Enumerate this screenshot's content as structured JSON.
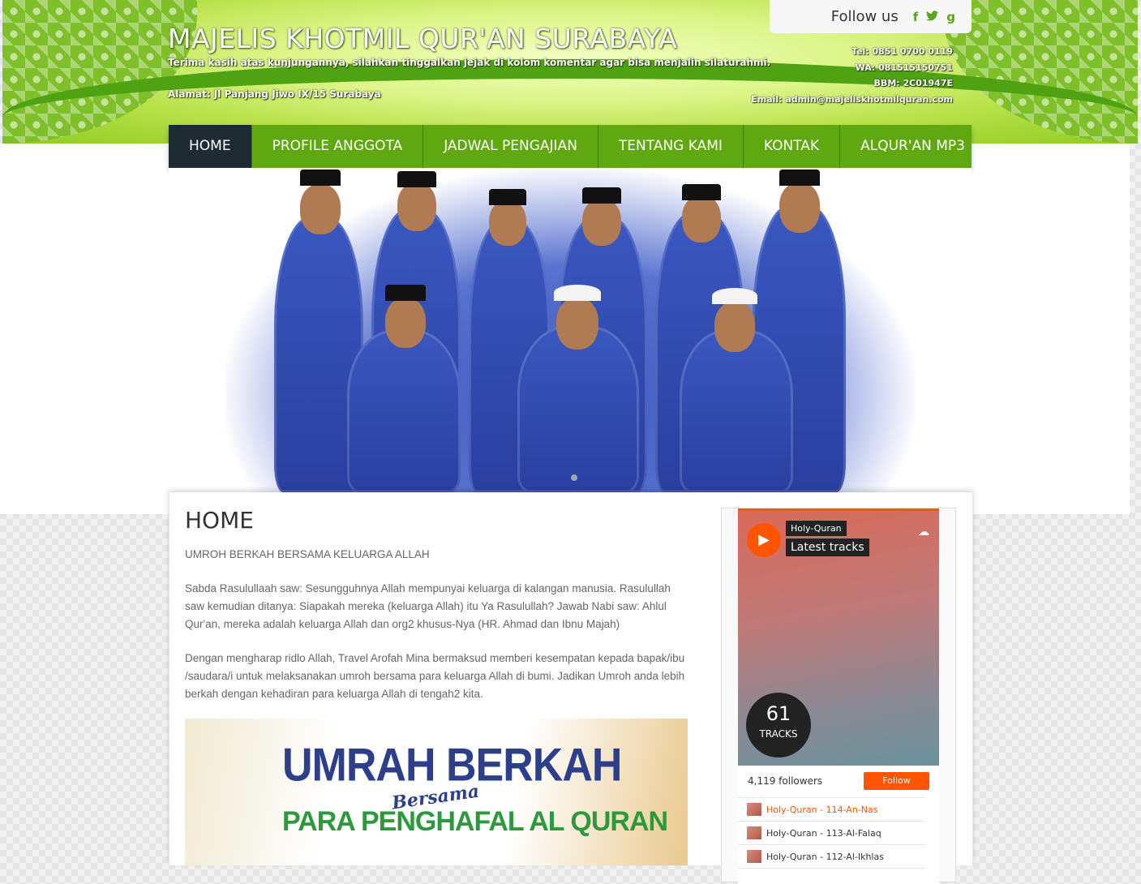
{
  "header": {
    "title": "MAJELIS KHOTMIL QUR'AN SURABAYA",
    "tagline": "Terima kasih atas kunjungannya, silahkan tinggalkan jejak di kolom komentar agar bisa menjalin silaturahmi.",
    "address": "Alamat: Jl Panjang Jiwo IX/15 Surabaya",
    "contact": {
      "tel": "Tel: 0851 0700 0119",
      "wa": "WA: 081515150751",
      "bbm": "BBM: 2C01947E",
      "email": "Email: admin@majeliskhotmilquran.com"
    },
    "follow": {
      "label": "Follow us",
      "icons": [
        "facebook-icon",
        "twitter-icon",
        "google-plus-icon"
      ]
    }
  },
  "nav": {
    "items": [
      {
        "label": "HOME",
        "active": true
      },
      {
        "label": "PROFILE ANGGOTA"
      },
      {
        "label": "JADWAL PENGAJIAN"
      },
      {
        "label": "TENTANG KAMI"
      },
      {
        "label": "KONTAK"
      },
      {
        "label": "ALQUR'AN MP3"
      }
    ]
  },
  "main": {
    "title": "HOME",
    "paragraphs": [
      "UMROH BERKAH BERSAMA KELUARGA ALLAH",
      "Sabda Rasulullaah saw: Sesungguhnya Allah mempunyai keluarga di kalangan manusia. Rasulullah saw kemudian ditanya: Siapakah mereka (keluarga Allah) itu Ya Rasulullah? Jawab Nabi saw: Ahlul Qur'an, mereka adalah keluarga Allah dan org2 khusus-Nya (HR. Ahmad dan Ibnu Majah)",
      "Dengan mengharap ridlo Allah, Travel Arofah Mina bermaksud memberi kesempatan kepada bapak/ibu /saudara/i untuk melaksanakan umroh bersama para keluarga Allah di bumi. Jadikan Umroh anda lebih berkah dengan kehadiran para keluarga Allah di tengah2 kita."
    ],
    "banner": {
      "line1": "UMRAH BERKAH",
      "line2": "Bersama",
      "line3": "PARA PENGHAFAL AL QURAN"
    }
  },
  "soundcloud": {
    "user": "Holy-Quran",
    "playlist": "Latest tracks",
    "track_count": "61",
    "track_label": "TRACKS",
    "followers": "4,119 followers",
    "follow_label": "Follow",
    "tracks": [
      "Holy-Quran - 114-An-Nas",
      "Holy-Quran - 113-Al-Falaq",
      "Holy-Quran - 112-Al-Ikhlas"
    ],
    "colors": {
      "accent": "#ff5500"
    }
  },
  "colors": {
    "nav_green": "#5fa80f",
    "nav_active": "#1f2b33"
  }
}
